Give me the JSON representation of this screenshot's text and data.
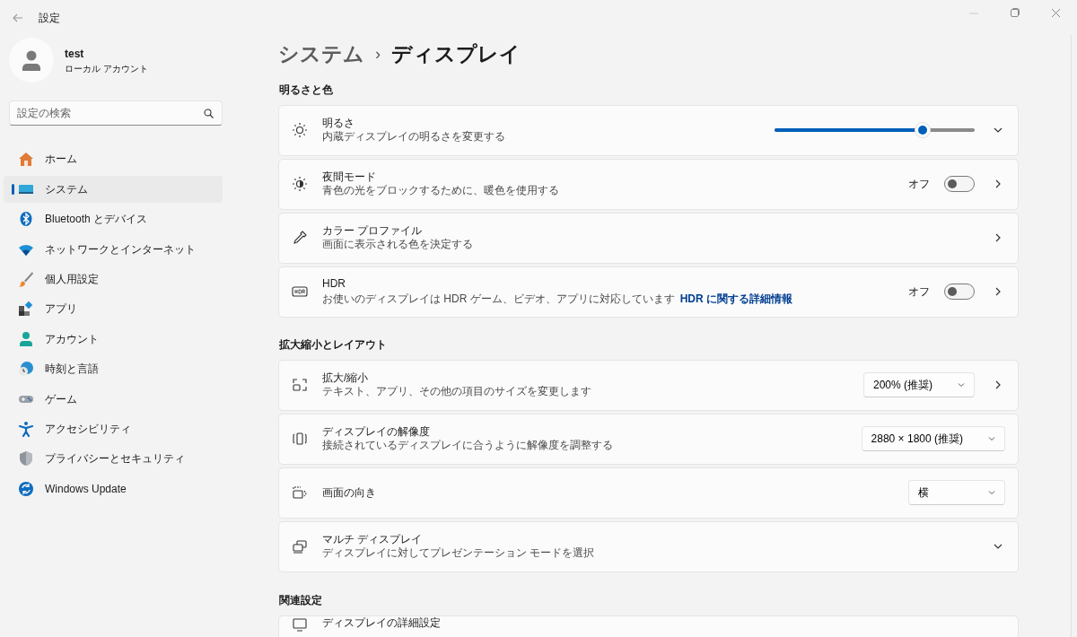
{
  "window": {
    "title": "設定"
  },
  "account": {
    "name": "test",
    "type": "ローカル アカウント"
  },
  "search": {
    "placeholder": "設定の検索"
  },
  "sidebar": {
    "items": [
      {
        "label": "ホーム",
        "selected": false
      },
      {
        "label": "システム",
        "selected": true
      },
      {
        "label": "Bluetooth とデバイス",
        "selected": false
      },
      {
        "label": "ネットワークとインターネット",
        "selected": false
      },
      {
        "label": "個人用設定",
        "selected": false
      },
      {
        "label": "アプリ",
        "selected": false
      },
      {
        "label": "アカウント",
        "selected": false
      },
      {
        "label": "時刻と言語",
        "selected": false
      },
      {
        "label": "ゲーム",
        "selected": false
      },
      {
        "label": "アクセシビリティ",
        "selected": false
      },
      {
        "label": "プライバシーとセキュリティ",
        "selected": false
      },
      {
        "label": "Windows Update",
        "selected": false
      }
    ]
  },
  "breadcrumb": {
    "parent": "システム",
    "separator": "›",
    "current": "ディスプレイ"
  },
  "sections": [
    {
      "title": "明るさと色",
      "rows": [
        {
          "title": "明るさ",
          "description": "内蔵ディスプレイの明るさを変更する",
          "kind": "slider",
          "level": 0.74,
          "expandable": true
        },
        {
          "title": "夜間モード",
          "description": "青色の光をブロックするために、暖色を使用する",
          "kind": "toggle",
          "state_label": "オフ",
          "on": false,
          "navigable": true
        },
        {
          "title": "カラー プロファイル",
          "description": "画面に表示される色を決定する",
          "kind": "link",
          "navigable": true
        },
        {
          "title": "HDR",
          "description": "お使いのディスプレイは HDR ゲーム、ビデオ、アプリに対応しています",
          "link": "HDR に関する詳細情報",
          "kind": "toggle",
          "state_label": "オフ",
          "on": false,
          "navigable": true
        }
      ]
    },
    {
      "title": "拡大縮小とレイアウト",
      "rows": [
        {
          "title": "拡大/縮小",
          "description": "テキスト、アプリ、その他の項目のサイズを変更します",
          "kind": "dropdown",
          "value": "200% (推奨)",
          "navigable": true
        },
        {
          "title": "ディスプレイの解像度",
          "description": "接続されているディスプレイに合うように解像度を調整する",
          "kind": "dropdown",
          "value": "2880 × 1800 (推奨)"
        },
        {
          "title": "画面の向き",
          "kind": "dropdown",
          "value": "横"
        },
        {
          "title": "マルチ ディスプレイ",
          "description": "ディスプレイに対してプレゼンテーション モードを選択",
          "kind": "link",
          "expandable": true
        }
      ]
    },
    {
      "title": "関連設定",
      "rows": [
        {
          "title": "ディスプレイの詳細設定",
          "kind": "link"
        }
      ]
    }
  ]
}
